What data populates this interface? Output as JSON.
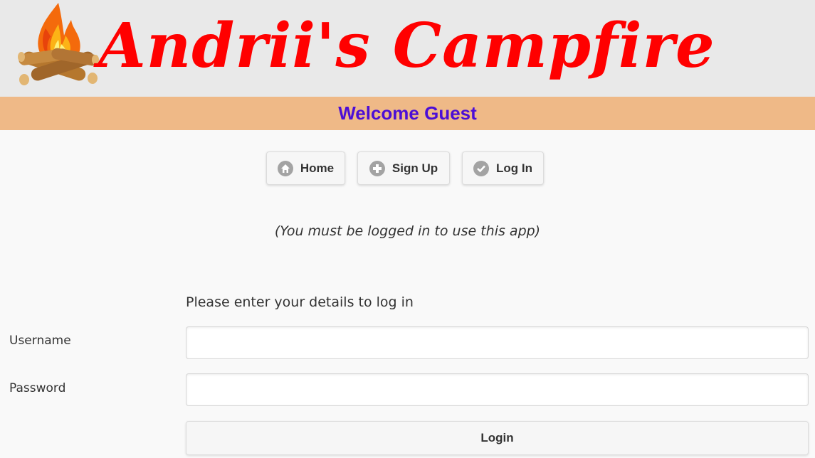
{
  "header": {
    "title": "Andrii's Campfire",
    "logo_icon": "campfire-icon"
  },
  "welcome": {
    "text": "Welcome Guest",
    "color": "#4b0ed6",
    "bar_color": "#efb987"
  },
  "nav": {
    "items": [
      {
        "label": "Home",
        "icon": "home-icon"
      },
      {
        "label": "Sign Up",
        "icon": "plus-icon"
      },
      {
        "label": "Log In",
        "icon": "check-icon"
      }
    ]
  },
  "notice": "(You must be logged in to use this app)",
  "form": {
    "heading": "Please enter your details to log in",
    "username_label": "Username",
    "username_value": "",
    "password_label": "Password",
    "password_value": "",
    "submit_label": "Login"
  },
  "colors": {
    "title": "#ff0000",
    "header_bg": "#e9e9e9",
    "page_bg": "#f9f9f9"
  }
}
